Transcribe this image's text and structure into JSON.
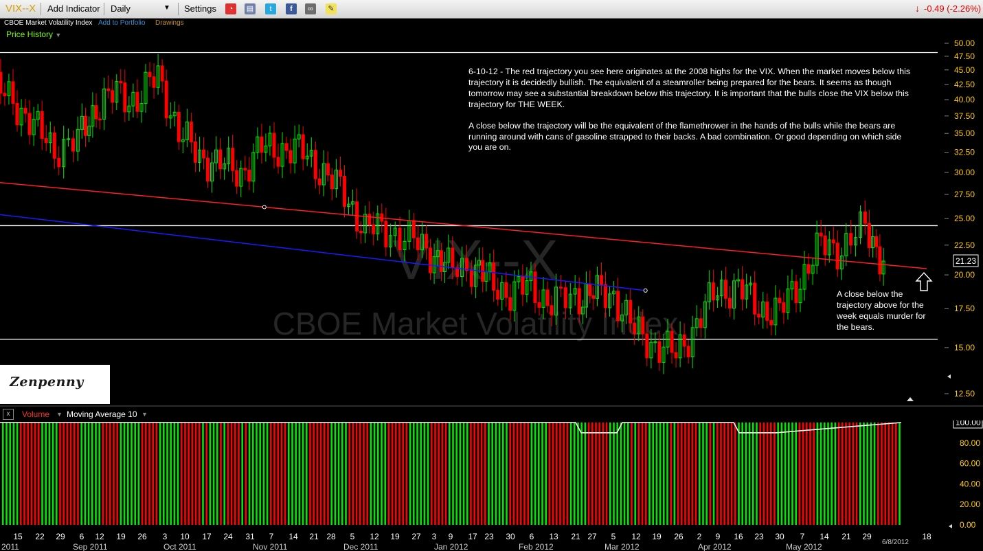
{
  "toolbar": {
    "symbol": "VIX--X",
    "add_indicator": "Add Indicator",
    "period": "Daily",
    "settings": "Settings",
    "change": "-0.49 (-2.26%)"
  },
  "subbar": {
    "name": "CBOE Market Volatility Index",
    "add_portfolio": "Add to Portfolio",
    "drawings": "Drawings"
  },
  "panel_label": "Price History",
  "watermark": {
    "symbol": "VIX--X",
    "name": "CBOE Market Volatility Index"
  },
  "annotation_main": [
    "6-10-12 - The red trajectory you see here originates at the 2008 highs for the VIX. When the market moves below this trajectory it is decidedly bullish. The equivalent of a steamroller being prepared for the bears. It seems as though tomorrow may see a substantial breakdown below this trajectory. It is important that the bulls close the VIX below this trajectory for THE WEEK.",
    "A close below the trajectory will be the equivalent of the flamethrower in the hands of the bulls while the bears are running around with cans of gasoline strapped to their backs. A bad combination. Or good depending on which side you are on."
  ],
  "annotation_side": "A close below the trajectory above for the week equals murder for the bears.",
  "logo_text": "Zenpenny",
  "volume_bar": {
    "volume_label": "Volume",
    "ma_label": "Moving Average 10",
    "close_glyph": "x"
  },
  "date_end": "6/8/2012",
  "colors": {
    "up": "#00e600",
    "down": "#ff0000",
    "trajectory_red": "#ff2020",
    "trajectory_blue": "#1a1aff",
    "levels": "#ffffff",
    "axis_text": "#ffcc00"
  },
  "chart_data": [
    {
      "type": "candlestick",
      "title": "VIX--X",
      "ylim": [
        12.5,
        50
      ],
      "y_scale": "log",
      "yticks": [
        "12.50",
        "15.00",
        "17.50",
        "20.00",
        "22.50",
        "25.00",
        "27.50",
        "30.00",
        "32.50",
        "35.00",
        "37.50",
        "40.00",
        "42.50",
        "45.00",
        "47.50",
        "50.00"
      ],
      "last_value": "21.23",
      "horizontal_levels": [
        48.2,
        24.3,
        15.5
      ],
      "trend_lines": [
        {
          "name": "red trajectory",
          "from": [
            "2011-08-01",
            29.1
          ],
          "to": [
            "2012-06-18",
            20.5
          ]
        },
        {
          "name": "blue trajectory",
          "from": [
            "2011-08-01",
            25.7
          ],
          "to": [
            "2012-03-15",
            18.8
          ]
        }
      ],
      "x_ticks": [
        "15",
        "22",
        "29",
        "6",
        "12",
        "19",
        "26",
        "3",
        "10",
        "17",
        "24",
        "31",
        "7",
        "14",
        "21",
        "28",
        "5",
        "12",
        "19",
        "27",
        "3",
        "9",
        "17",
        "23",
        "30",
        "6",
        "13",
        "21",
        "27",
        "5",
        "12",
        "19",
        "26",
        "2",
        "9",
        "16",
        "23",
        "30",
        "7",
        "14",
        "21",
        "29",
        "18"
      ],
      "x_months": [
        "2011",
        "Sep 2011",
        "Oct 2011",
        "Nov 2011",
        "Dec 2011",
        "Jan 2012",
        "Feb 2012",
        "Mar 2012",
        "Apr 2012",
        "May 2012",
        "6/8/2012"
      ],
      "series": [
        {
          "name": "weekly close path",
          "x": [
            "2011-08-08",
            "2011-08-15",
            "2011-08-22",
            "2011-08-29",
            "2011-09-06",
            "2011-09-12",
            "2011-09-19",
            "2011-09-26",
            "2011-10-03",
            "2011-10-10",
            "2011-10-17",
            "2011-10-24",
            "2011-10-31",
            "2011-11-07",
            "2011-11-14",
            "2011-11-21",
            "2011-11-28",
            "2011-12-05",
            "2011-12-12",
            "2011-12-19",
            "2011-12-27",
            "2012-01-03",
            "2012-01-09",
            "2012-01-17",
            "2012-01-23",
            "2012-01-30",
            "2012-02-06",
            "2012-02-13",
            "2012-02-21",
            "2012-02-27",
            "2012-03-05",
            "2012-03-12",
            "2012-03-19",
            "2012-03-26",
            "2012-04-02",
            "2012-04-09",
            "2012-04-16",
            "2012-04-23",
            "2012-04-30",
            "2012-05-07",
            "2012-05-14",
            "2012-05-21",
            "2012-05-29",
            "2012-06-04"
          ],
          "values": [
            42,
            40,
            36,
            33,
            34,
            39,
            41,
            40,
            44,
            35,
            32,
            31,
            30,
            33,
            33,
            32.5,
            30,
            27.5,
            24,
            24,
            23,
            22,
            20.5,
            20.8,
            19.5,
            18.6,
            19.2,
            17.8,
            18.4,
            18.6,
            18.5,
            16,
            15.2,
            14.6,
            16.5,
            18.9,
            19,
            17.6,
            17.2,
            19.7,
            22.5,
            22.2,
            24.1,
            21.2
          ]
        }
      ]
    },
    {
      "type": "bar",
      "title": "Volume",
      "ylim": [
        0,
        100
      ],
      "yticks": [
        "0.00",
        "20.00",
        "40.00",
        "60.00",
        "80.00",
        "100.00"
      ],
      "series": [
        {
          "name": "Moving Average 10",
          "values": [
            100,
            100,
            90,
            90,
            100,
            100,
            90,
            90,
            100
          ]
        }
      ]
    }
  ]
}
